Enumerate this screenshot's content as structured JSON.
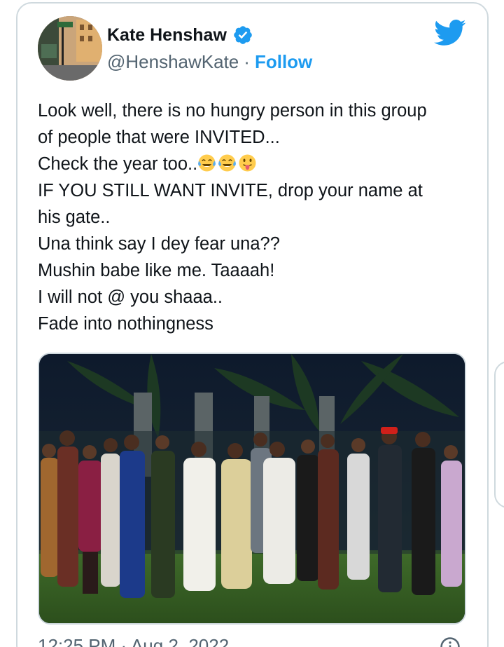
{
  "author": {
    "name": "Kate Henshaw",
    "handle": "@HenshawKate",
    "separator": "·",
    "follow_label": "Follow",
    "verified": true
  },
  "icons": {
    "brand": "twitter-bird-icon",
    "verified": "verified-badge-icon",
    "info": "info-icon",
    "emojis": [
      "face-with-tears-of-joy",
      "face-with-tears-of-joy",
      "face-with-tongue"
    ]
  },
  "tweet": {
    "lines": [
      "Look well, there is no hungry person in this group",
      "of people that were INVITED...",
      "Check the year too..",
      "IF YOU STILL WANT INVITE, drop your name at",
      "his gate..",
      "Una think say I dey fear una??",
      "Mushin babe like me. Taaaah!",
      "I will not @ you shaaa..",
      "Fade into nothingness"
    ]
  },
  "footer": {
    "timestamp": "12:25 PM · Aug 2, 2022"
  },
  "colors": {
    "accent": "#1d9bf0",
    "text": "#0f1419",
    "secondary": "#536471",
    "border": "#cfd9de"
  }
}
